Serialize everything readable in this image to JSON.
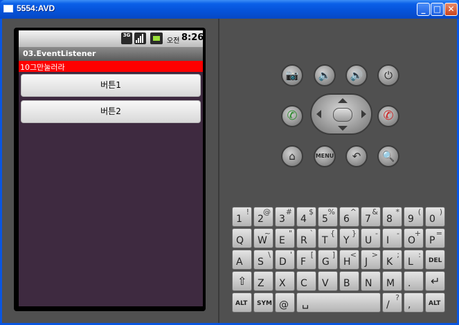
{
  "window": {
    "title": "5554:AVD",
    "minimize": "_",
    "maximize": "□",
    "close": "✕"
  },
  "phone": {
    "status": {
      "net_badge": "3G",
      "ampm": "오전",
      "time": "8:26"
    },
    "app_title": "03.EventListener",
    "textview": "10그만눌러라",
    "button1": "버튼1",
    "button2": "버튼2"
  },
  "controls": {
    "camera": "📷",
    "vol_down": "🔉",
    "vol_up": "🔊",
    "power": "⏻",
    "call": "✆",
    "end_call": "✆",
    "home": "⌂",
    "menu": "MENU",
    "back": "↶",
    "search": "🔍"
  },
  "keyboard": {
    "row1": [
      {
        "k": "1",
        "a": "!"
      },
      {
        "k": "2",
        "a": "@"
      },
      {
        "k": "3",
        "a": "#"
      },
      {
        "k": "4",
        "a": "$"
      },
      {
        "k": "5",
        "a": "%"
      },
      {
        "k": "6",
        "a": "^"
      },
      {
        "k": "7",
        "a": "&"
      },
      {
        "k": "8",
        "a": "*"
      },
      {
        "k": "9",
        "a": "("
      },
      {
        "k": "0",
        "a": ")"
      }
    ],
    "row2": [
      {
        "k": "Q",
        "a": ""
      },
      {
        "k": "W",
        "a": "~"
      },
      {
        "k": "E",
        "a": "\""
      },
      {
        "k": "R",
        "a": "`"
      },
      {
        "k": "T",
        "a": "{"
      },
      {
        "k": "Y",
        "a": "}"
      },
      {
        "k": "U",
        "a": "-"
      },
      {
        "k": "I",
        "a": "-"
      },
      {
        "k": "O",
        "a": "+"
      },
      {
        "k": "P",
        "a": "="
      }
    ],
    "row3": [
      {
        "k": "A",
        "a": ""
      },
      {
        "k": "S",
        "a": "\\"
      },
      {
        "k": "D",
        "a": "'"
      },
      {
        "k": "F",
        "a": "["
      },
      {
        "k": "G",
        "a": "]"
      },
      {
        "k": "H",
        "a": "<"
      },
      {
        "k": "J",
        "a": ">"
      },
      {
        "k": "K",
        "a": ";"
      },
      {
        "k": "L",
        "a": ":"
      },
      {
        "k": "DEL",
        "a": ""
      }
    ],
    "row4": [
      {
        "k": "⇧",
        "a": ""
      },
      {
        "k": "Z",
        "a": ""
      },
      {
        "k": "X",
        "a": ""
      },
      {
        "k": "C",
        "a": ""
      },
      {
        "k": "V",
        "a": ""
      },
      {
        "k": "B",
        "a": ""
      },
      {
        "k": "N",
        "a": ""
      },
      {
        "k": "M",
        "a": ""
      },
      {
        "k": ".",
        "a": ""
      },
      {
        "k": "↵",
        "a": ""
      }
    ],
    "row5": [
      {
        "k": "ALT",
        "a": ""
      },
      {
        "k": "SYM",
        "a": ""
      },
      {
        "k": "@",
        "a": ""
      },
      {
        "k": "␣",
        "a": ""
      },
      {
        "k": "/",
        "a": "?"
      },
      {
        "k": ",",
        "a": ""
      },
      {
        "k": "ALT",
        "a": ""
      }
    ]
  }
}
